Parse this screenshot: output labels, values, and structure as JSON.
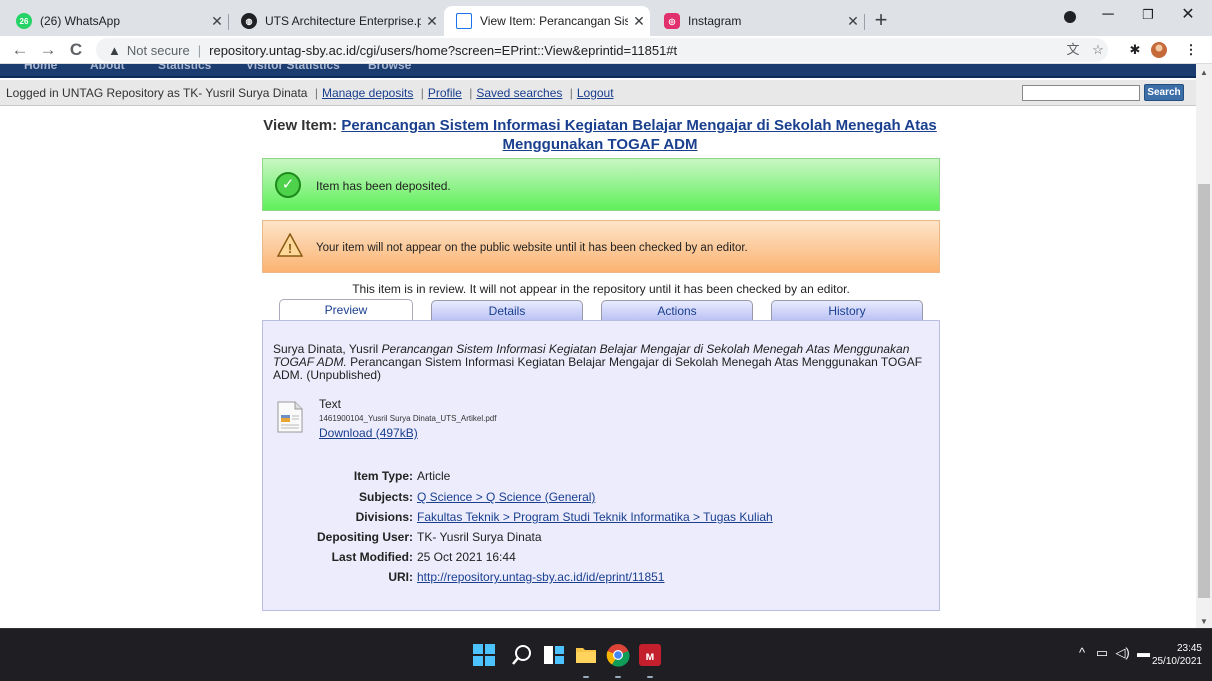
{
  "browser": {
    "tabs": [
      {
        "title": "(26) WhatsApp",
        "badge": "26",
        "icon": "whatsapp-icon",
        "color": "#25d366"
      },
      {
        "title": "UTS Architecture Enterprise.pdf",
        "icon": "globe-icon",
        "color": "#202124"
      },
      {
        "title": "View Item: Perancangan Sistem In",
        "icon": "document-icon",
        "color": "#1a73e8"
      },
      {
        "title": "Instagram",
        "icon": "instagram-icon",
        "color": "#e1306c"
      }
    ],
    "address": {
      "security": "Not secure",
      "url": "repository.untag-sby.ac.id/cgi/users/home?screen=EPrint::View&eprintid=11851#t"
    }
  },
  "site_nav": [
    "Home",
    "About",
    "Statistics",
    "Visitor Statistics",
    "Browse"
  ],
  "login_bar": {
    "prefix": "Logged in UNTAG Repository as TK- Yusril Surya Dinata",
    "links": [
      "Manage deposits",
      "Profile",
      "Saved searches",
      "Logout"
    ],
    "search_button": "Search"
  },
  "view_title": {
    "prefix": "View Item:",
    "title": "Perancangan Sistem Informasi Kegiatan Belajar Mengajar di Sekolah Menegah Atas Menggunakan TOGAF ADM"
  },
  "messages": {
    "success": "Item has been deposited.",
    "warning": "Your item will not appear on the public website until it has been checked by an editor.",
    "review": "This item is in review. It will not appear in the repository until it has been checked by an editor."
  },
  "item_tabs": [
    "Preview",
    "Details",
    "Actions",
    "History"
  ],
  "citation": {
    "authors": "Surya Dinata, Yusril",
    "title_italic": "Perancangan Sistem Informasi Kegiatan Belajar Mengajar di Sekolah Menegah Atas Menggunakan TOGAF ADM.",
    "rest": "Perancangan Sistem Informasi Kegiatan Belajar Mengajar di Sekolah Menegah Atas Menggunakan TOGAF ADM. (Unpublished)"
  },
  "document": {
    "format": "Text",
    "filename": "1461900104_Yusril Surya Dinata_UTS_Artikel.pdf",
    "download": "Download (497kB)"
  },
  "metadata": [
    {
      "key": "Item Type:",
      "value": "Article",
      "link": false
    },
    {
      "key": "Subjects:",
      "value": "Q Science > Q Science (General)",
      "link": true
    },
    {
      "key": "Divisions:",
      "value": "Fakultas Teknik > Program Studi Teknik Informatika > Tugas Kuliah",
      "link": true
    },
    {
      "key": "Depositing User:",
      "value": "TK- Yusril Surya Dinata",
      "link": false
    },
    {
      "key": "Last Modified:",
      "value": "25 Oct 2021 16:44",
      "link": false
    },
    {
      "key": "URI:",
      "value": "http://repository.untag-sby.ac.id/id/eprint/11851",
      "link": true
    }
  ],
  "taskbar": {
    "time": "23:45",
    "date": "25/10/2021"
  }
}
